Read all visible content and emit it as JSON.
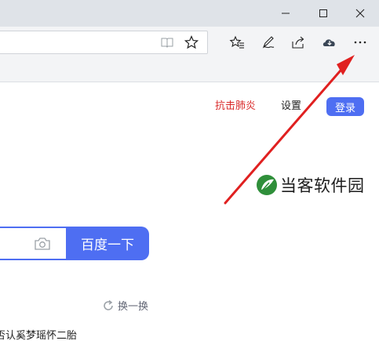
{
  "header": {
    "links": {
      "virus": "抗击肺炎",
      "settings": "设置"
    },
    "login_label": "登录"
  },
  "watermark": {
    "text": "当客软件园"
  },
  "search": {
    "button_label": "百度一下"
  },
  "hot": {
    "refresh_label": "换一换",
    "first_item": "否认奚梦瑶怀二胎"
  },
  "colors": {
    "brand_blue": "#4e6ef2",
    "alert_red": "#d92a2a",
    "annotation_red": "#e02020"
  },
  "icons": {
    "toolbar": [
      "reading-view-icon",
      "favorite-star-icon",
      "favorites-list-icon",
      "pen-icon",
      "share-icon",
      "cloud-download-icon",
      "more-options-icon"
    ],
    "window": [
      "minimize-icon",
      "maximize-icon",
      "close-icon"
    ]
  }
}
